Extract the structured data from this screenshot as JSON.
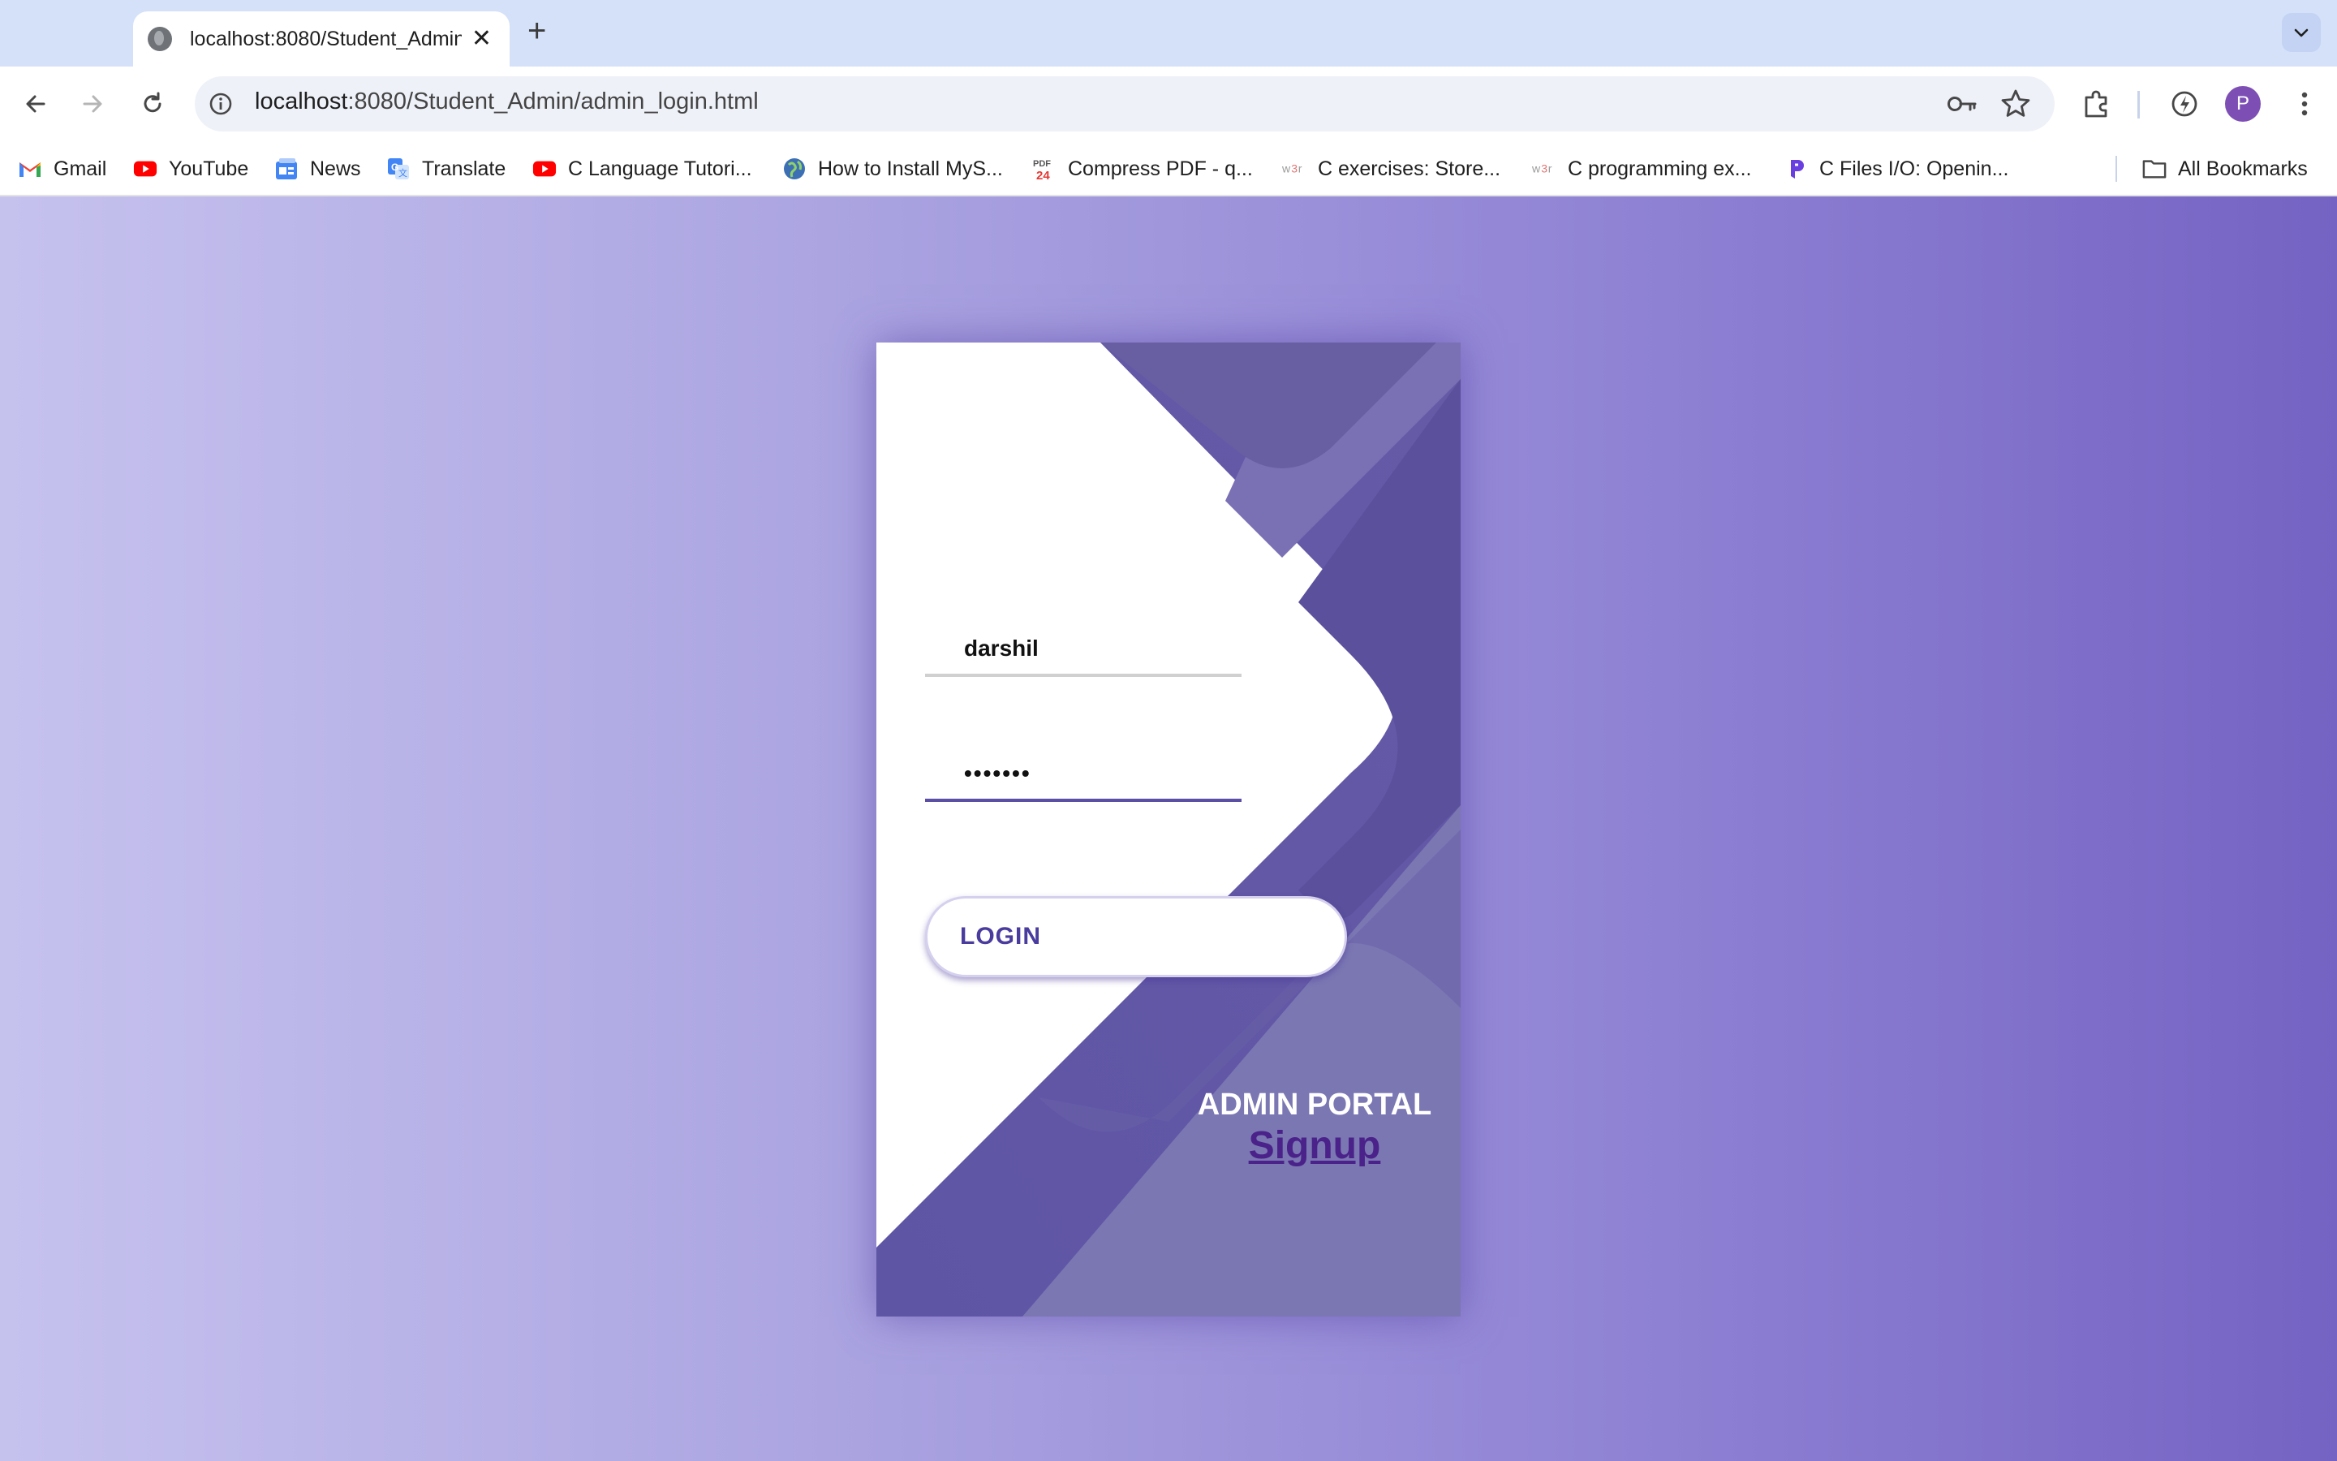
{
  "browser": {
    "tab_title": "localhost:8080/Student_Admin/admin_login.html",
    "url_host": "localhost",
    "url_rest": ":8080/Student_Admin/admin_login.html",
    "profile_initial": "P"
  },
  "bookmarks": [
    {
      "label": "Gmail",
      "icon": "gmail-icon"
    },
    {
      "label": "YouTube",
      "icon": "youtube-icon"
    },
    {
      "label": "News",
      "icon": "news-icon"
    },
    {
      "label": "Translate",
      "icon": "translate-icon"
    },
    {
      "label": "C Language Tutori...",
      "icon": "youtube-icon"
    },
    {
      "label": "How to Install MyS...",
      "icon": "globe-icon"
    },
    {
      "label": "Compress PDF - q...",
      "icon": "pdf24-icon"
    },
    {
      "label": "C exercises: Store...",
      "icon": "w3r-icon"
    },
    {
      "label": "C programming ex...",
      "icon": "w3r-icon"
    },
    {
      "label": "C Files I/O: Openin...",
      "icon": "programiz-icon"
    }
  ],
  "all_bookmarks_label": "All Bookmarks",
  "login": {
    "username_value": "darshil",
    "password_value": "•••••••",
    "button_label": "LOGIN",
    "portal_title": "ADMIN PORTAL",
    "signup_link": "Signup"
  },
  "colors": {
    "accent": "#5a4fa4",
    "signup": "#4a228a",
    "page_gradient_start": "#c6c2ee",
    "page_gradient_end": "#7563c3"
  }
}
